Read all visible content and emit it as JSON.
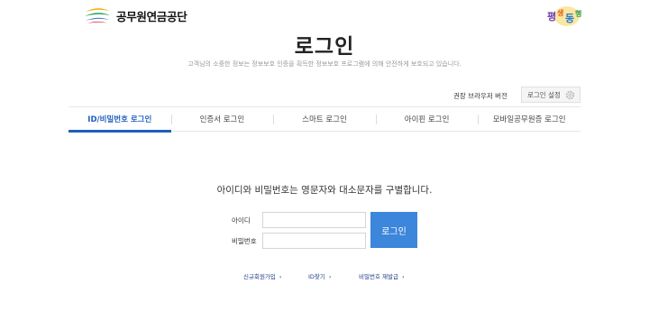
{
  "header": {
    "org_name": "공무원연금공단",
    "badge_text": "평생동행"
  },
  "title": "로그인",
  "subtitle": "고객님의 소중한 정보는 정보보호 인증을 획득한 정보보호 프로그램에 의해 안전하게 보호되고 있습니다.",
  "browser": {
    "label": "권장 브라우저 버전",
    "settings_label": "로그인 설정"
  },
  "tabs": [
    {
      "label": "ID/비밀번호 로그인",
      "active": true
    },
    {
      "label": "인증서 로그인",
      "active": false
    },
    {
      "label": "스마트 로그인",
      "active": false
    },
    {
      "label": "아이핀 로그인",
      "active": false
    },
    {
      "label": "모바일공무원증 로그인",
      "active": false
    }
  ],
  "form": {
    "notice": "아이디와 비밀번호는 영문자와 대소문자를 구별합니다.",
    "id_label": "아이디",
    "id_value": "",
    "pw_label": "비밀번호",
    "pw_value": "",
    "submit_label": "로그인"
  },
  "links": {
    "signup": "신규회원가입",
    "find_id": "ID찾기",
    "reset_pw": "비밀번호 재발급",
    "chevron": "›"
  },
  "colors": {
    "accent": "#1f5fbf",
    "button": "#3c86db",
    "link": "#1f3e8a"
  }
}
